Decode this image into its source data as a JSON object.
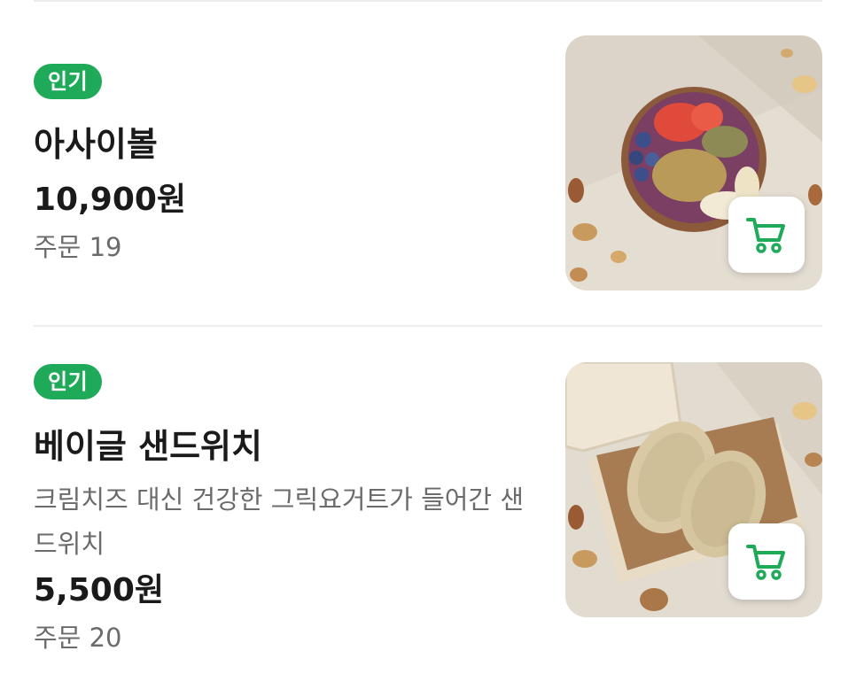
{
  "accent_color": "#1faa59",
  "items": [
    {
      "badge": "인기",
      "name": "아사이볼",
      "price": "10,900원",
      "orders": "주문 19",
      "image": "acai-bowl-photo",
      "cart_icon": "cart-icon"
    },
    {
      "badge": "인기",
      "name": "베이글 샌드위치",
      "description": "크림치즈 대신 건강한 그릭요거트가 들어간 샌드위치",
      "price": "5,500원",
      "orders": "주문 20",
      "image": "bagel-sandwich-photo",
      "cart_icon": "cart-icon"
    }
  ]
}
